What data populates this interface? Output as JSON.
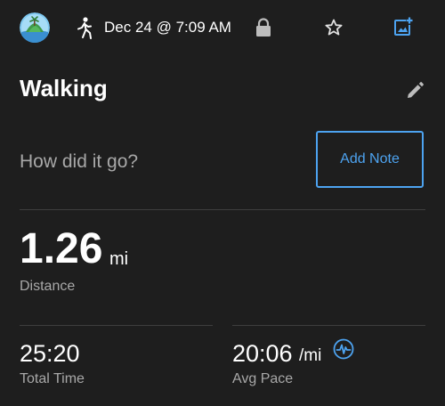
{
  "header": {
    "activity_icon": "walking-person-icon",
    "date": "Dec 24 @ 7:09 AM",
    "icons": {
      "avatar": "profile-avatar",
      "lock": "lock-icon",
      "favorite": "star-outline-icon",
      "add_photo": "add-photo-icon"
    }
  },
  "activity": {
    "title": "Walking",
    "edit_icon": "pencil-icon"
  },
  "note": {
    "prompt": "How did it go?",
    "button_label": "Add Note"
  },
  "stats": {
    "distance": {
      "value": "1.26",
      "unit": "mi",
      "label": "Distance"
    },
    "total_time": {
      "value": "25:20",
      "label": "Total Time"
    },
    "avg_pace": {
      "value": "20:06",
      "unit": "/mi",
      "label": "Avg Pace",
      "icon": "pulse-chart-icon"
    }
  },
  "colors": {
    "background": "#1e1e1e",
    "accent": "#4da3f0",
    "secondary_text": "#a8a8a8",
    "divider": "#3e3e3e"
  }
}
